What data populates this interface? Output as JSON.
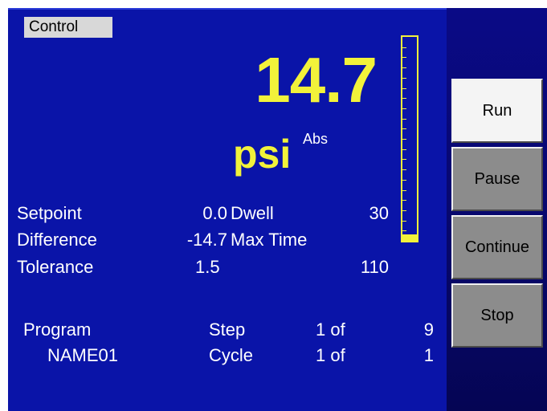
{
  "panel": {
    "title": "Control"
  },
  "reading": {
    "value": "14.7",
    "unit": "psi",
    "reference": "Abs",
    "gauge_level_fraction": 0.03
  },
  "params": {
    "setpoint_label": "Setpoint",
    "setpoint_value": "0.0",
    "dwell_label": "Dwell",
    "dwell_value": "30",
    "difference_label": "Difference",
    "difference_value": "-14.7",
    "maxtime_label": "Max Time",
    "tolerance_label": "Tolerance",
    "tolerance_value": "1.5",
    "maxtime_value": "110"
  },
  "program": {
    "label": "Program",
    "name": "NAME01",
    "step_label": "Step",
    "step_current": "1 of",
    "step_total": "9",
    "cycle_label": "Cycle",
    "cycle_current": "1 of",
    "cycle_total": "1"
  },
  "buttons": {
    "run": "Run",
    "pause": "Pause",
    "continue": "Continue",
    "stop": "Stop"
  },
  "colors": {
    "screen_bg": "#0a14a8",
    "accent_yellow": "#f2f23a",
    "button_active": "#f4f4f4",
    "button_inactive": "#8c8c8c"
  }
}
